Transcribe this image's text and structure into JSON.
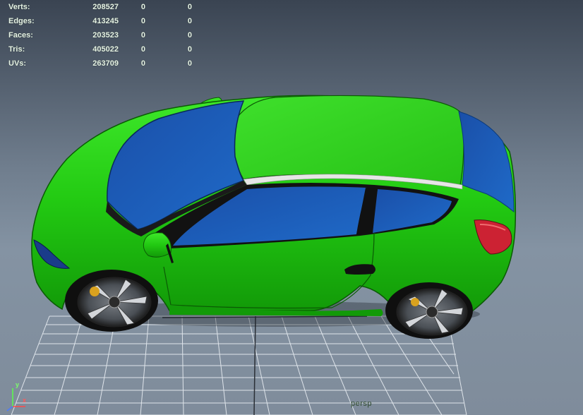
{
  "hud": {
    "rows": [
      {
        "label": "Verts:",
        "v1": "208527",
        "v2": "0",
        "v3": "0"
      },
      {
        "label": "Edges:",
        "v1": "413245",
        "v2": "0",
        "v3": "0"
      },
      {
        "label": "Faces:",
        "v1": "203523",
        "v2": "0",
        "v3": "0"
      },
      {
        "label": "Tris:",
        "v1": "405022",
        "v2": "0",
        "v3": "0"
      },
      {
        "label": "UVs:",
        "v1": "263709",
        "v2": "0",
        "v3": "0"
      }
    ]
  },
  "axis": {
    "y_label": "y",
    "x_label": "x"
  },
  "camera": {
    "name": "persp"
  },
  "colors": {
    "body": "#22cc11",
    "glass": "#1b5fb8",
    "tail_light": "#cc2233",
    "grid": "#e8eef2"
  }
}
